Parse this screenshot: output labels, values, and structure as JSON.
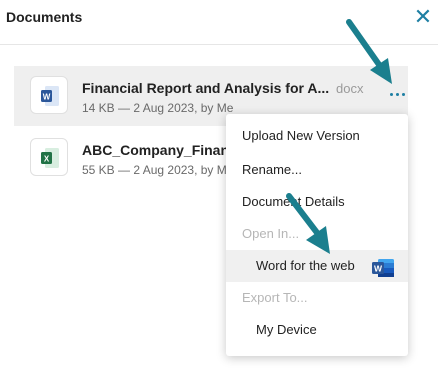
{
  "header": {
    "title": "Documents",
    "close_glyph": "✕"
  },
  "files": [
    {
      "name": "Financial Report and Analysis for A...",
      "extension": "docx",
      "meta": "14 KB — 2 Aug 2023, by Me",
      "icon": "word-file-icon",
      "selected": true
    },
    {
      "name": "ABC_Company_Finan",
      "extension": "",
      "meta": "55 KB — 2 Aug 2023, by M",
      "icon": "excel-file-icon",
      "selected": false
    }
  ],
  "menu": {
    "items": [
      {
        "label": "Upload New Version",
        "enabled": true
      },
      {
        "label": "Rename...",
        "enabled": true
      },
      {
        "label": "Document Details",
        "enabled": true
      },
      {
        "label": "Open In...",
        "enabled": false
      },
      {
        "label": "Word for the web",
        "enabled": true,
        "sub": true,
        "icon": "word-app-icon"
      },
      {
        "label": "Export To...",
        "enabled": false
      },
      {
        "label": "My Device",
        "enabled": true,
        "sub": true
      }
    ]
  },
  "colors": {
    "accent": "#1e7fa3",
    "arrow": "#1b7f8e",
    "word": "#2b579a",
    "excel": "#217346"
  }
}
